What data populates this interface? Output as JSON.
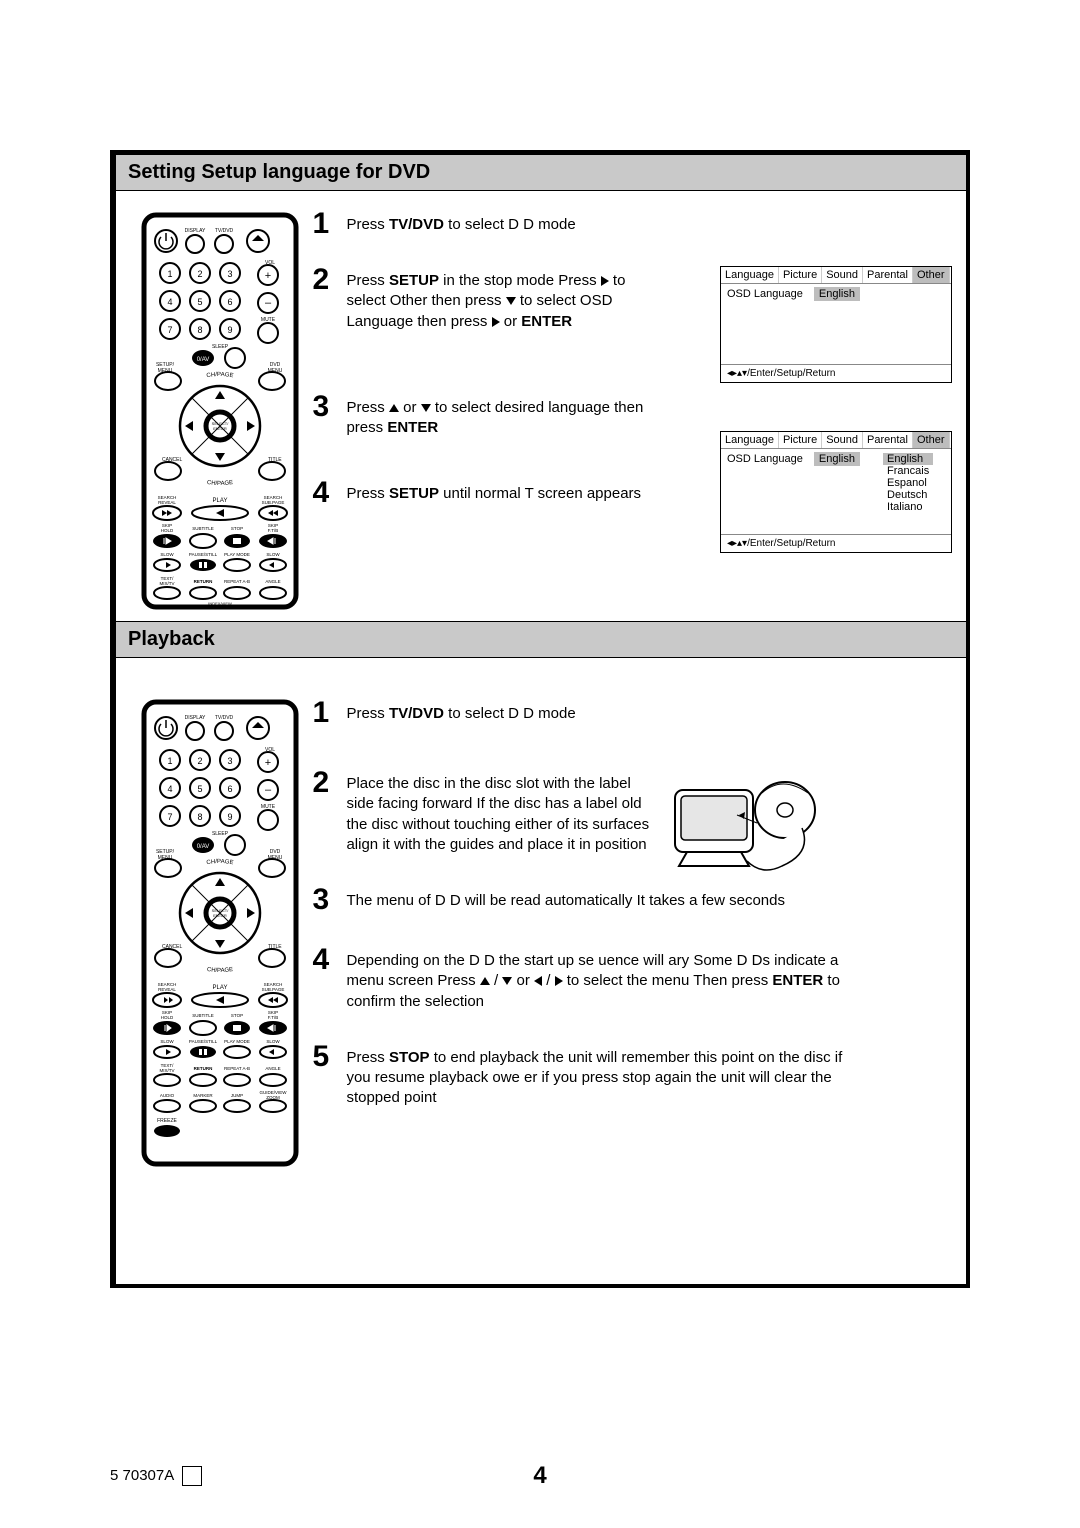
{
  "section1": {
    "title": "Setting Setup language for DVD",
    "steps": {
      "s1": "Press <b>TV/DVD</b> to select D D mode",
      "s2": "Press <b>SETUP</b> in the stop mode  Press <span class='tri r'></span> to select  Other  then press <span class='tri d'></span> to select  OSD Language  then press <span class='tri r'></span> or <b>ENTER</b>",
      "s3": "Press <span class='tri u'></span> or <span class='tri d'></span> to select desired language  then press <b>ENTER</b>",
      "s4": "Press <b>SETUP</b> until normal T   screen appears"
    },
    "osd1": {
      "tabs": [
        "Language",
        "Picture",
        "Sound",
        "Parental",
        "Other"
      ],
      "sel_tab": 4,
      "row_label": "OSD Language",
      "row_value": "English",
      "foot": "◂▸▴▾/Enter/Setup/Return"
    },
    "osd2": {
      "tabs": [
        "Language",
        "Picture",
        "Sound",
        "Parental",
        "Other"
      ],
      "sel_tab": 4,
      "row_label": "OSD Language",
      "row_value": "English",
      "langlist": [
        "English",
        "Francais",
        "Espanol",
        "Deutsch",
        "Italiano"
      ],
      "sel_lang": 0,
      "foot": "◂▸▴▾/Enter/Setup/Return"
    }
  },
  "section2": {
    "title": "Playback",
    "steps": {
      "s1": "Press <b>TV/DVD</b> to select D D mode",
      "s2": "Place the disc in the disc slot with the label side facing forward  If the disc has a label  old the disc without touching either of its surfaces  align it with the guides  and place it in position",
      "s3": "The menu of D D will be read automatically  It takes a few seconds",
      "s4": "Depending on the D D the start up se uence will  ary Some D Ds indicate a menu screen  Press <span class='tri u'></span> / <span class='tri d'></span> or <span class='tri l'></span> / <span class='tri r'></span> to select the menu  Then press <b>ENTER</b> to confirm the selection",
      "s5": "Press <b>STOP</b> to end playback   the unit will remember this point on the disc if you resume playback    owe er if you press stop again  the unit will clear the stopped point"
    }
  },
  "remote_labels": {
    "top": [
      "DISPLAY",
      "TV/DVD"
    ],
    "vol": "VOL",
    "mute": "MUTE",
    "sleep": "SLEEP",
    "setup": "SETUP/\nMENU",
    "dvdmenu": "DVD\nMENU",
    "chpage": "CH/PAGE",
    "select": "SELECT/\nENTER",
    "cancel": "CANCEL",
    "title": "TITLE",
    "search_reveal": "SEARCH\nREVEAL",
    "play": "PLAY",
    "search_subpage": "SEARCH\nSUB.PAGE",
    "skip_hold": "SKIP\nHOLD",
    "subtitle": "SUBTITLE",
    "stop": "STOP",
    "skip_ftb": "SKIP\nF.T/B",
    "slow1": "SLOW",
    "pause": "PAUSE/STILL",
    "playmode": "PLAY MODE",
    "slow2": "SLOW",
    "text": "TEXT/\nMIX/TV",
    "return": "RETURN",
    "repeat": "REPEAT A-B",
    "angle": "ANGLE",
    "audio": "AUDIO",
    "marker": "MARKER",
    "jump": "JUMP",
    "guide": "GUIDE/VIEW\nZOOM",
    "freeze": "FREEZE",
    "index": "INDEX/VIEW"
  },
  "footer": {
    "code": "5  70307A",
    "page": "4"
  }
}
